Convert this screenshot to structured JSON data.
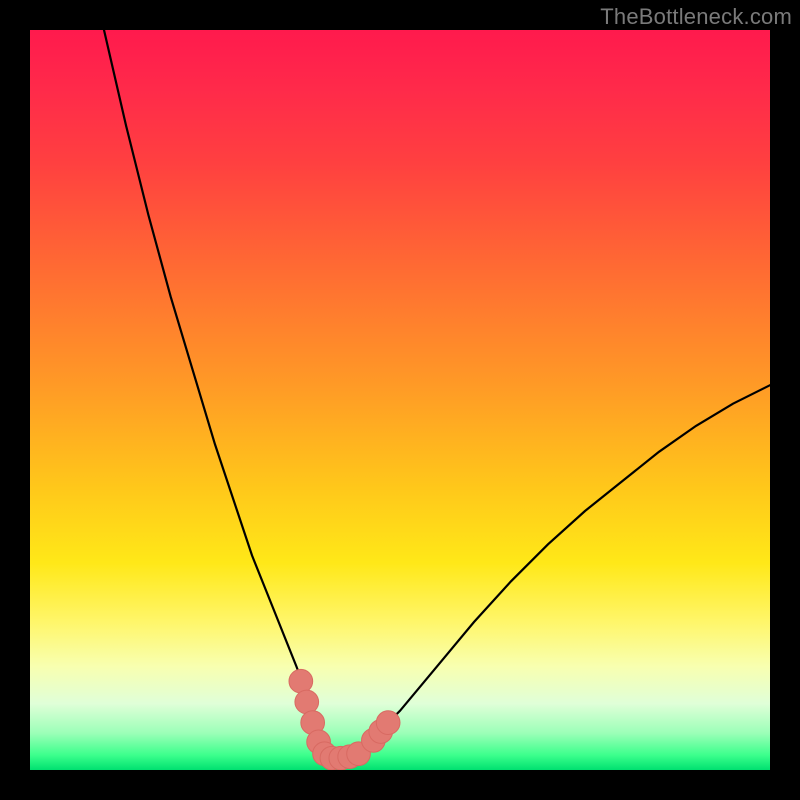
{
  "watermark": "TheBottleneck.com",
  "colors": {
    "curve": "#000000",
    "marker_fill": "#e27a72",
    "marker_stroke": "#d86a62"
  },
  "chart_data": {
    "type": "line",
    "title": "",
    "xlabel": "",
    "ylabel": "",
    "xlim": [
      0,
      100
    ],
    "ylim": [
      0,
      100
    ],
    "series": [
      {
        "name": "curve",
        "x": [
          10,
          13,
          16,
          19,
          22,
          25,
          28,
          30,
          32,
          34,
          36,
          37.5,
          39,
          40,
          41,
          43,
          45,
          50,
          55,
          60,
          65,
          70,
          75,
          80,
          85,
          90,
          95,
          100
        ],
        "y": [
          100,
          87,
          75,
          64,
          54,
          44,
          35,
          29,
          24,
          19,
          14,
          10,
          6,
          3.5,
          2,
          2,
          3,
          8,
          14,
          20,
          25.5,
          30.5,
          35,
          39,
          43,
          46.5,
          49.5,
          52
        ]
      }
    ],
    "markers": [
      {
        "x": 36.6,
        "y": 12.0,
        "r": 1.6
      },
      {
        "x": 37.4,
        "y": 9.2,
        "r": 1.6
      },
      {
        "x": 38.2,
        "y": 6.4,
        "r": 1.6
      },
      {
        "x": 39.0,
        "y": 3.8,
        "r": 1.6
      },
      {
        "x": 39.8,
        "y": 2.2,
        "r": 1.6
      },
      {
        "x": 40.8,
        "y": 1.6,
        "r": 1.6
      },
      {
        "x": 42.0,
        "y": 1.6,
        "r": 1.6
      },
      {
        "x": 43.2,
        "y": 1.8,
        "r": 1.6
      },
      {
        "x": 44.4,
        "y": 2.2,
        "r": 1.6
      },
      {
        "x": 46.4,
        "y": 4.0,
        "r": 1.6
      },
      {
        "x": 47.4,
        "y": 5.2,
        "r": 1.6
      },
      {
        "x": 48.4,
        "y": 6.4,
        "r": 1.6
      }
    ]
  }
}
